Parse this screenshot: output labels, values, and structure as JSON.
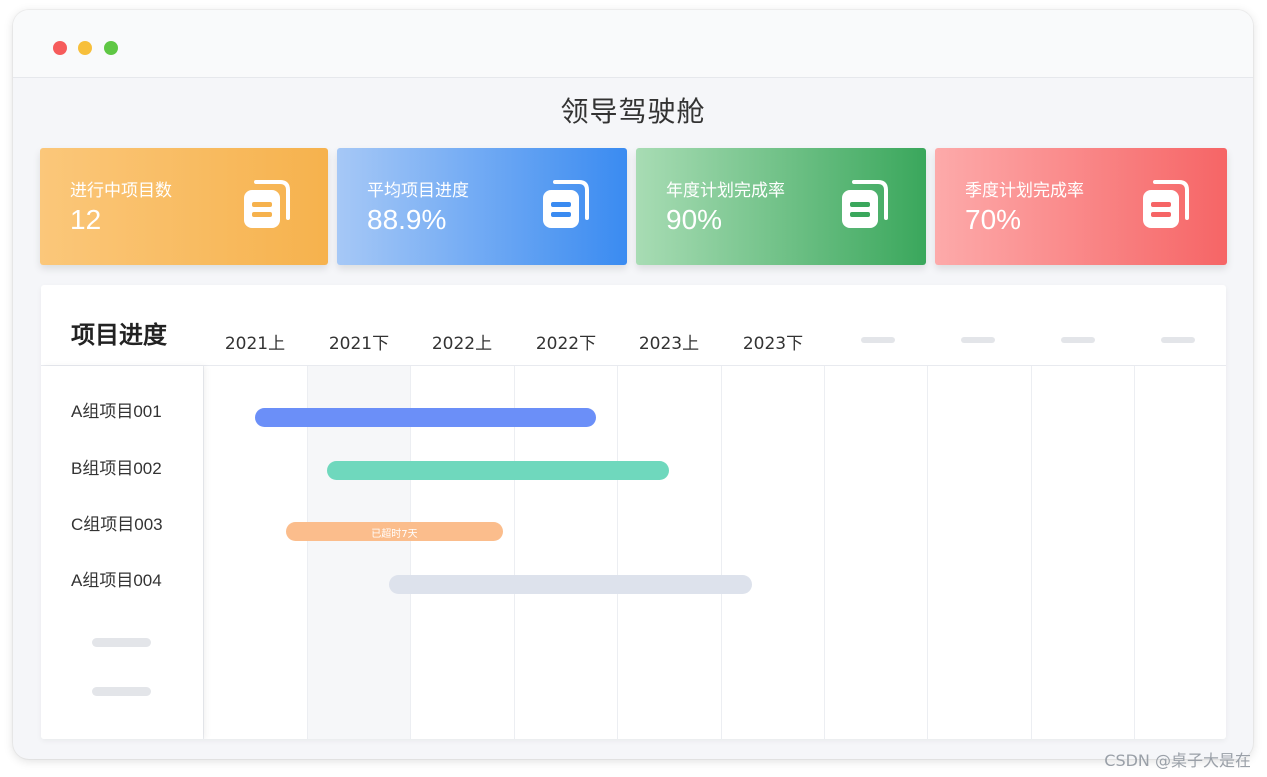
{
  "window": {
    "title": "领导驾驶舱"
  },
  "kpis": [
    {
      "label": "进行中项目数",
      "value": "12",
      "icon": "documents-icon",
      "icon_color": "#f6b24d"
    },
    {
      "label": "平均项目进度",
      "value": "88.9%",
      "icon": "documents-icon",
      "icon_color": "#3a8bf1"
    },
    {
      "label": "年度计划完成率",
      "value": "90%",
      "icon": "documents-icon",
      "icon_color": "#3aa75c"
    },
    {
      "label": "季度计划完成率",
      "value": "70%",
      "icon": "documents-icon",
      "icon_color": "#f66566"
    }
  ],
  "gantt": {
    "title": "项目进度",
    "periods": [
      "2021上",
      "2021下",
      "2022上",
      "2022下",
      "2023上",
      "2023下"
    ],
    "projects": [
      {
        "name": "A组项目001",
        "start": 0.5,
        "end": 3.8,
        "color": "#6b8ff8",
        "note": ""
      },
      {
        "name": "B组项目002",
        "start": 1.2,
        "end": 4.5,
        "color": "#6fd8bd",
        "note": ""
      },
      {
        "name": "C组项目003",
        "start": 0.8,
        "end": 2.9,
        "color": "#fbbd8c",
        "note": "已超时7天"
      },
      {
        "name": "A组项目004",
        "start": 1.8,
        "end": 5.3,
        "color": "#dde2ec",
        "note": ""
      }
    ]
  },
  "watermark": "CSDN @桌子大是在"
}
